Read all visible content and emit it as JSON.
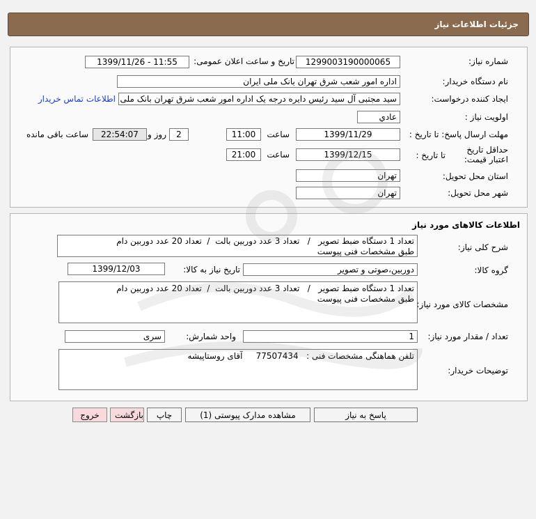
{
  "header": {
    "title": "جزئیات اطلاعات نیاز"
  },
  "details": {
    "need_number_label": "شماره نیاز:",
    "need_number": "1299003190000065",
    "announce_label": "تاریخ و ساعت اعلان عمومی:",
    "announce_value": "1399/11/26 - 11:55",
    "buyer_org_label": "نام دستگاه خریدار:",
    "buyer_org": "اداره امور شعب شرق تهران بانک ملی ایران",
    "requester_label": "ایجاد کننده درخواست:",
    "requester": "سید مجتبی  آل سید  رئیس دایره درجه یک  اداره امور شعب شرق تهران بانک ملی ایران",
    "contact_link": "اطلاعات تماس خریدار",
    "priority_label": "اولویت نیاز :",
    "priority": "عادي",
    "reply_deadline_label": "مهلت ارسال پاسخ:  تا تاریخ :",
    "reply_date": "1399/11/29",
    "time_label": "ساعت",
    "reply_time": "11:00",
    "days_value": "2",
    "days_label": "روز و",
    "remaining_time": "22:54:07",
    "remaining_label": "ساعت باقی مانده",
    "price_validity_label": "حداقل تاریخ اعتبار قیمت:",
    "price_validity_until": "تا تاریخ :",
    "price_date": "1399/12/15",
    "price_time_label": "ساعت",
    "price_time": "21:00",
    "province_label": "استان محل تحویل:",
    "province": "تهران",
    "city_label": "شهر محل تحویل:",
    "city": "تهران"
  },
  "goods": {
    "title": "اطلاعات کالاهای مورد نیاز",
    "general_desc_label": "شرح کلی نیاز:",
    "general_desc": "تعداد 1 دستگاه ضبط تصویر   /   تعداد 3 عدد دوربین بالت  /  تعداد 20 عدد دوربین دام\nطبق مشخصات فنی پیوست",
    "group_label": "گروه کالا:",
    "group_value": "دوربین،صوتی و تصویر",
    "need_date_label": "تاریخ نیاز به کالا:",
    "need_date": "1399/12/03",
    "specs_label": "مشخصات کالای مورد نیاز:",
    "specs": "تعداد 1 دستگاه ضبط تصویر   /   تعداد 3 عدد دوربین بالت  /  تعداد 20 عدد دوربین دام\nطبق مشخصات فنی پیوست",
    "quantity_label": "تعداد / مقدار مورد نیاز:",
    "quantity": "1",
    "unit_label": "واحد شمارش:",
    "unit": "سری",
    "buyer_notes_label": "توضیحات خریدار:",
    "buyer_notes": "تلفن هماهنگی مشخصات فنی :   77507434     آقای روستاپیشه"
  },
  "buttons": {
    "reply": "پاسخ به نیاز",
    "attachments": "مشاهده مدارک پیوستی (1)",
    "print": "چاپ",
    "back": "بازگشت",
    "exit": "خروج"
  }
}
